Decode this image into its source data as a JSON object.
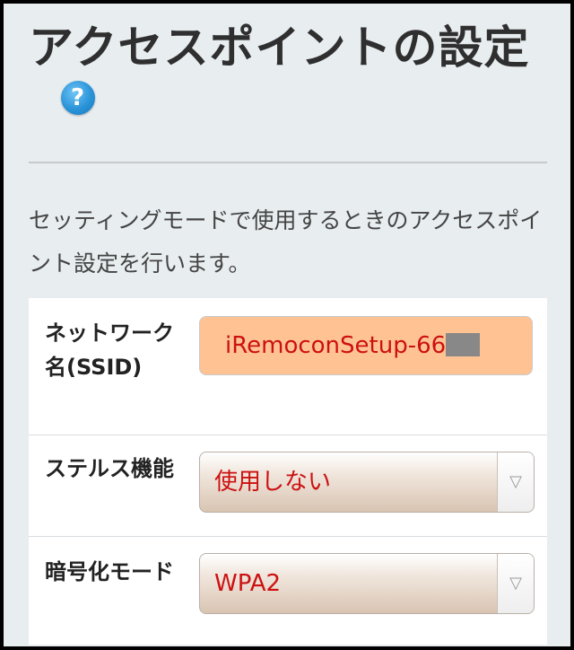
{
  "header": {
    "title": "アクセスポイントの設定",
    "help_icon": "help-icon",
    "help_glyph": "?"
  },
  "description": "セッティングモードで使用するときのアクセスポイント設定を行います。",
  "form": {
    "ssid": {
      "label": "ネットワーク名(SSID)",
      "value": "iRemoconSetup-66"
    },
    "stealth": {
      "label": "ステルス機能",
      "value": "使用しない"
    },
    "encryption": {
      "label": "暗号化モード",
      "value": "WPA2"
    },
    "dropdown_icon": "chevron-down-icon",
    "dropdown_glyph": "▽"
  },
  "colors": {
    "input_background": "#ffc393",
    "value_text": "#cc1111",
    "page_background": "#e8edf0",
    "help_icon": "#2a93d8"
  }
}
